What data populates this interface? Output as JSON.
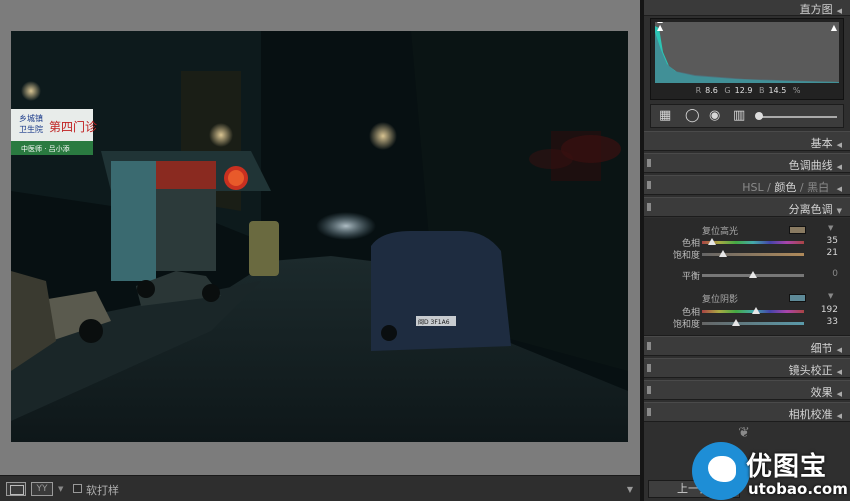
{
  "toolbar": {
    "yy_label": "YY",
    "soft_proof_label": "软打样"
  },
  "histogram": {
    "title": "直方图",
    "r_label": "R",
    "r_value": "8.6",
    "g_label": "G",
    "g_value": "12.9",
    "b_label": "B",
    "b_value": "14.5",
    "unit": "%"
  },
  "panels": {
    "basic": "基本",
    "tone_curve": "色调曲线",
    "hsl": "HSL",
    "color": "颜色",
    "bw": "黑白",
    "separator": "/",
    "split_toning": "分离色调",
    "detail": "细节",
    "lens": "镜头校正",
    "effects": "效果",
    "camera": "相机校准"
  },
  "split_toning": {
    "highlights": {
      "label": "复位高光",
      "swatch": "#8a7b62",
      "hue_label": "色相",
      "hue": 35,
      "sat_label": "饱和度",
      "sat": 21
    },
    "balance": {
      "label": "平衡",
      "value": 0
    },
    "shadows": {
      "label": "复位阴影",
      "swatch": "#5e8a98",
      "hue_label": "色相",
      "hue": 192,
      "sat_label": "饱和度",
      "sat": 33
    }
  },
  "footer": {
    "prev_label": "上一张"
  },
  "photo_signs": {
    "clinic_line1": "乡城镇",
    "clinic_line2": "卫生院",
    "clinic_main": "第四门诊",
    "clinic_sub": "中医师 · 吕小添",
    "plate": "闽D 3F1A6"
  },
  "watermark": {
    "cn": "优图宝",
    "en": "utobao.com"
  },
  "colors": {
    "histogram_fill": "#2cc4b4",
    "accent_blue": "#1e8ed6"
  }
}
